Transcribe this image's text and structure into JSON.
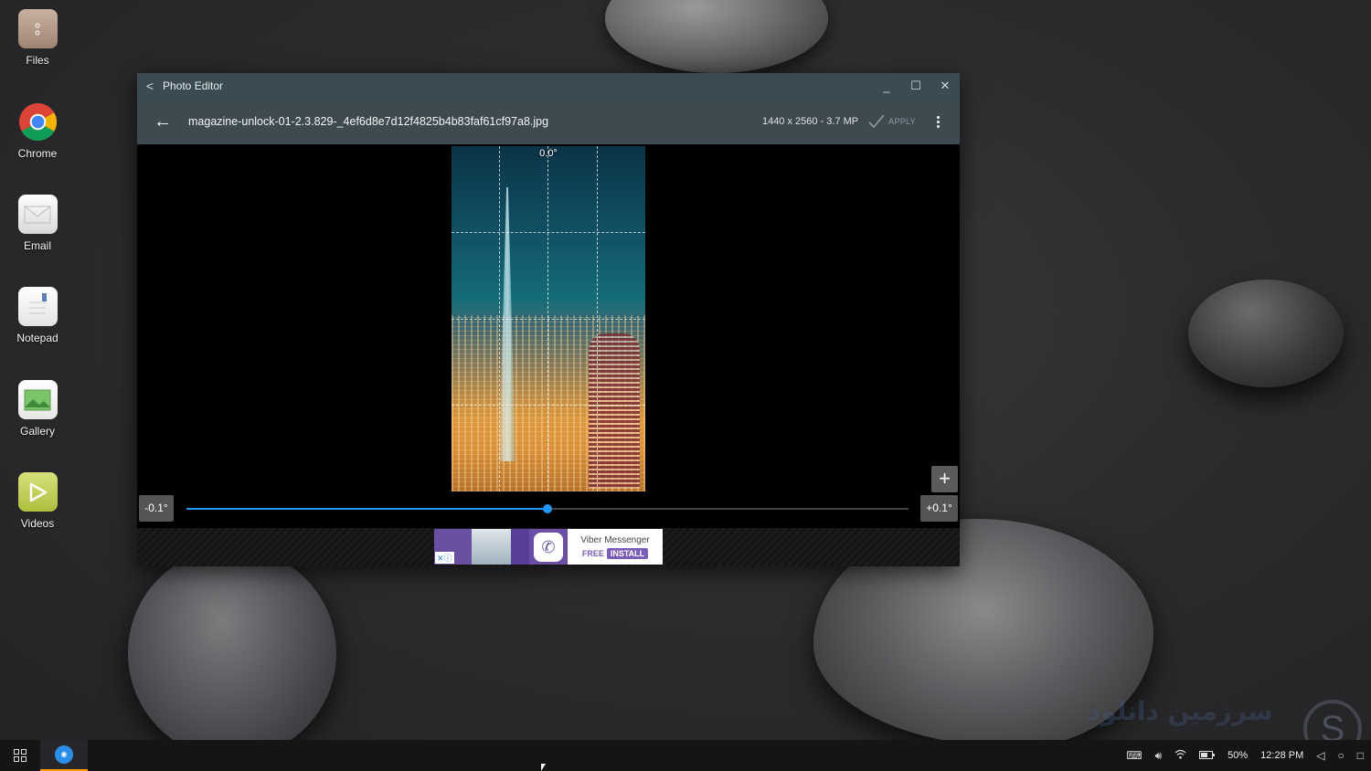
{
  "desktop": {
    "icons": [
      {
        "label": "Files"
      },
      {
        "label": "Chrome"
      },
      {
        "label": "Email"
      },
      {
        "label": "Notepad"
      },
      {
        "label": "Gallery"
      },
      {
        "label": "Videos"
      }
    ]
  },
  "window": {
    "title": "Photo Editor",
    "back_glyph": "<",
    "minimize_glyph": "_",
    "maximize_glyph": "☐",
    "close_glyph": "✕"
  },
  "toolbar": {
    "back_glyph": "←",
    "filename": "magazine-unlock-01-2.3.829-_4ef6d8e7d12f4825b4b83faf61cf97a8.jpg",
    "resolution": "1440 x 2560 - 3.7 MP",
    "apply_label": "APPLY"
  },
  "editor": {
    "angle_label": "0.0°",
    "plus_glyph": "+",
    "minus_step_label": "-0.1°",
    "plus_step_label": "+0.1°",
    "slider_value": 0.5
  },
  "ad": {
    "app_name": "Viber Messenger",
    "free_label": "FREE",
    "install_label": "INSTALL",
    "close_glyph": "✕ⓘ"
  },
  "taskbar": {
    "battery": "50%",
    "time": "12:28 PM",
    "colors": {
      "accent": "#ff9800"
    }
  },
  "colors": {
    "titlebar": "#3b4b53",
    "toolbar": "#3d4a50",
    "slider": "#2196f3",
    "ad_brand": "#7b5cb8"
  }
}
